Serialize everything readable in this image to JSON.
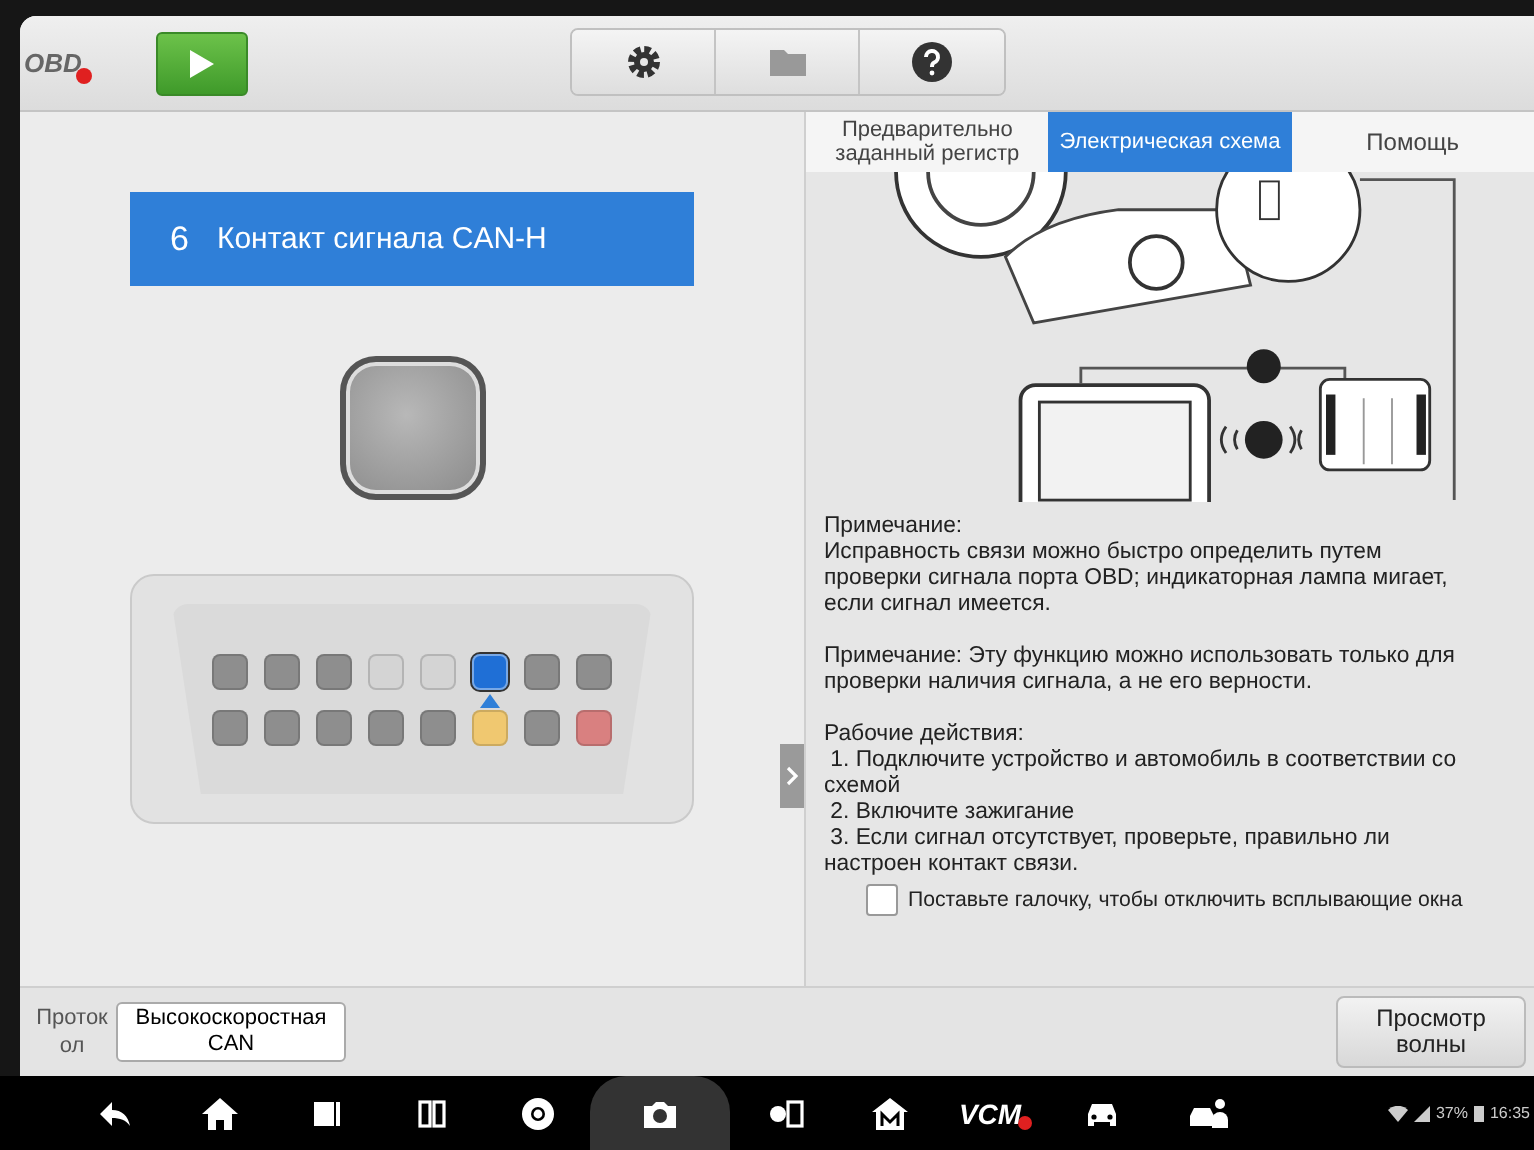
{
  "toolbar": {
    "logo": "OBD",
    "logo_error": true
  },
  "pin_banner": {
    "number": "6",
    "label": "Контакт сигнала CAN-H"
  },
  "connector": {
    "pins": [
      {
        "color": "#8e8e8e",
        "selected": false
      },
      {
        "color": "#8e8e8e",
        "selected": false
      },
      {
        "color": "#8e8e8e",
        "selected": false
      },
      {
        "color": "#d4d4d4",
        "selected": false
      },
      {
        "color": "#d4d4d4",
        "selected": false
      },
      {
        "color": "#1f6fd6",
        "selected": true
      },
      {
        "color": "#8e8e8e",
        "selected": false
      },
      {
        "color": "#8e8e8e",
        "selected": false
      },
      {
        "color": "#8e8e8e",
        "selected": false
      },
      {
        "color": "#8e8e8e",
        "selected": false
      },
      {
        "color": "#8e8e8e",
        "selected": false
      },
      {
        "color": "#8e8e8e",
        "selected": false
      },
      {
        "color": "#8e8e8e",
        "selected": false
      },
      {
        "color": "#f0c870",
        "selected": false
      },
      {
        "color": "#8e8e8e",
        "selected": false
      },
      {
        "color": "#d98080",
        "selected": false
      }
    ]
  },
  "tabs": [
    {
      "label": "Предварительно заданный регистр",
      "selected": false
    },
    {
      "label": "Электрическая схема",
      "selected": true
    },
    {
      "label": "Помощь",
      "selected": false
    }
  ],
  "notes": [
    [
      "Примечание:",
      "Исправность связи можно быстро определить путем проверки сигнала порта OBD; индикаторная лампа мигает, если сигнал имеется."
    ],
    [
      "Примечание: Эту функцию можно использовать только для проверки наличия сигнала, а не его верности."
    ],
    [
      "Рабочие действия:",
      " 1. Подключите устройство и автомобиль в соответствии со схемой",
      " 2. Включите зажигание",
      " 3. Если сигнал отсутствует, проверьте, правильно ли настроен контакт связи."
    ]
  ],
  "popup_checkbox": {
    "label": "Поставьте галочку, чтобы отключить всплывающие окна",
    "checked": false
  },
  "bottom_bar": {
    "protocol_label": "Проток ол",
    "protocol_value": "Высокоскоростная CAN",
    "wave_button": "Просмотр волны"
  },
  "nav_bar": {
    "vcm_label": "VCM",
    "battery": "37%",
    "time": "16:35"
  }
}
